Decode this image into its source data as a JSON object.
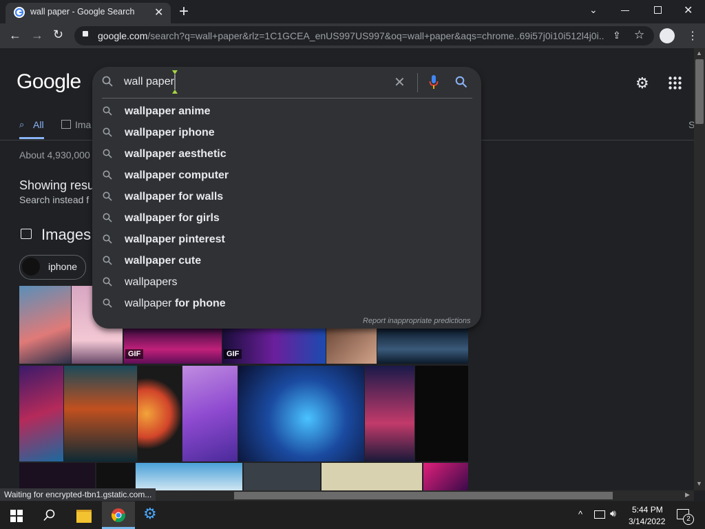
{
  "browser": {
    "tab_title": "wall paper - Google Search",
    "new_tab": "+",
    "url_host": "google.com",
    "url_rest": "/search?q=wall+paper&rlz=1C1GCEA_enUS997US997&oq=wall+paper&aqs=chrome..69i57j0i10i512l4j0i..."
  },
  "search": {
    "logo": "Google",
    "query": "wall paper",
    "report": "Report inappropriate predictions",
    "suggestions": [
      {
        "bold": "wallpaper anime",
        "rest": ""
      },
      {
        "bold": "wallpaper iphone",
        "rest": ""
      },
      {
        "bold": "wallpaper aesthetic",
        "rest": ""
      },
      {
        "bold": "wallpaper computer",
        "rest": ""
      },
      {
        "bold": "wallpaper for walls",
        "rest": ""
      },
      {
        "bold": "wallpaper for girls",
        "rest": ""
      },
      {
        "bold": "wallpaper pinterest",
        "rest": ""
      },
      {
        "bold": "wallpaper cute",
        "rest": ""
      },
      {
        "plain": "wallpapers"
      },
      {
        "plain": "wallpaper ",
        "boldtail": "for phone"
      }
    ]
  },
  "results": {
    "tab_all": "All",
    "tab_images": "Ima",
    "tab_right": "S",
    "about": "About 4,930,000",
    "showing": "Showing resu",
    "search_instead": "Search instead f",
    "images_heading": "Images",
    "chip": "iphone",
    "gif_label": "GIF"
  },
  "status": "Waiting for encrypted-tbn1.gstatic.com...",
  "taskbar": {
    "time": "5:44 PM",
    "date": "3/14/2022",
    "notif_count": "2"
  }
}
